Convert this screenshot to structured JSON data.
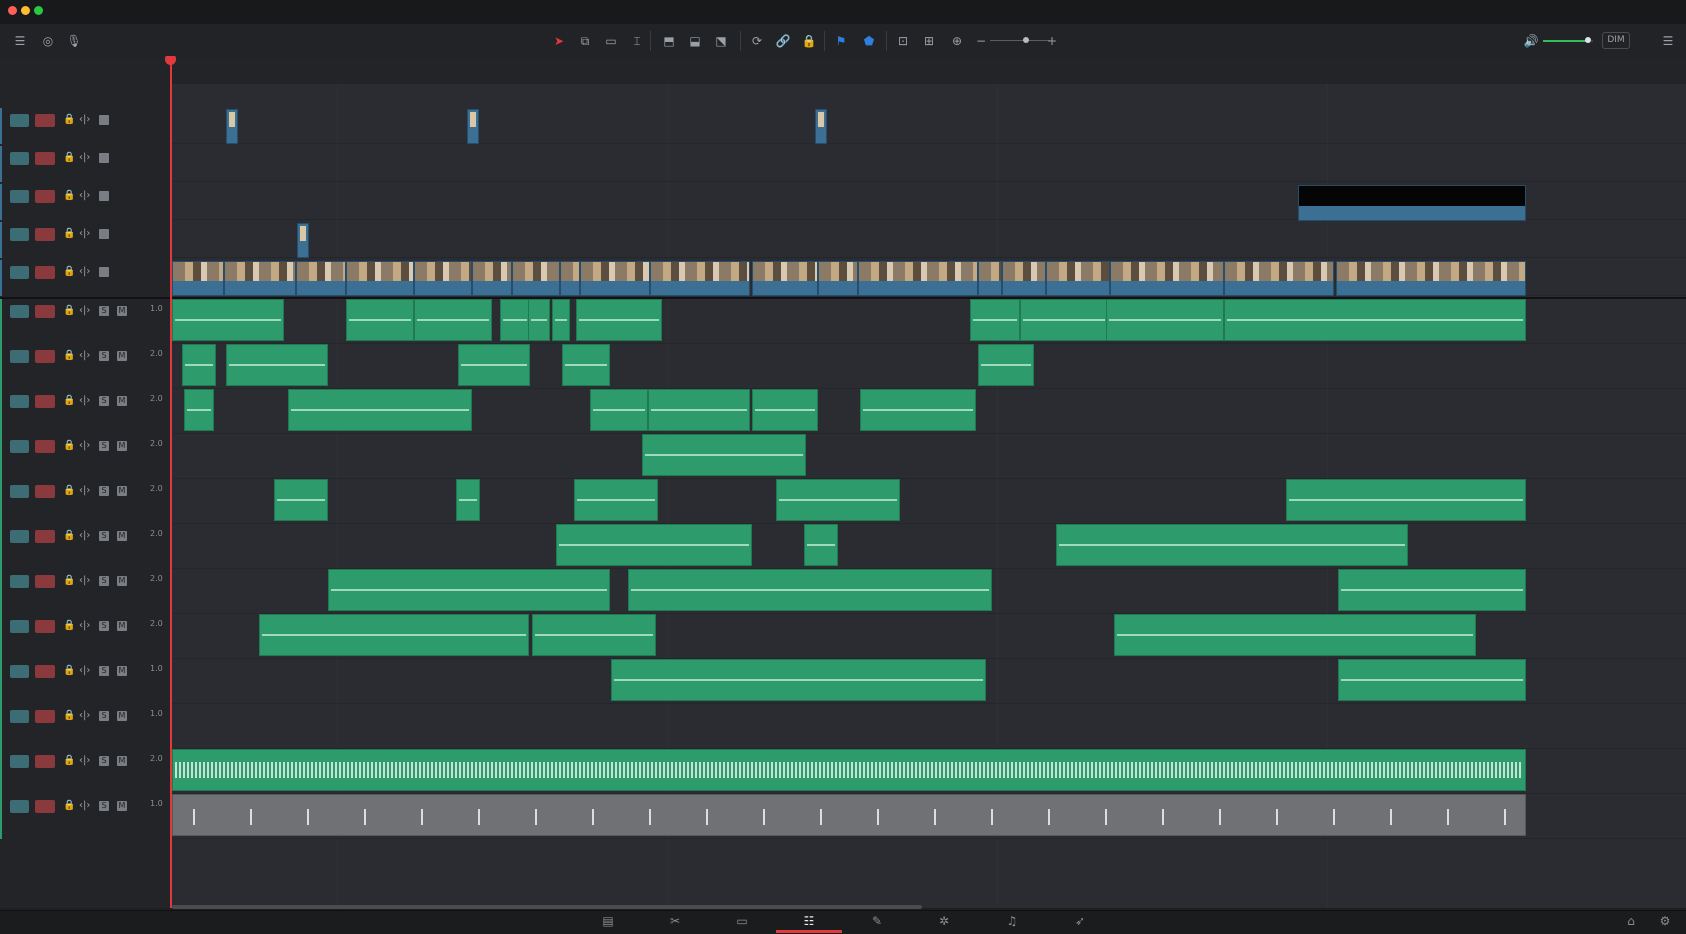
{
  "window": {
    "title": "",
    "traffic_lights": [
      "#ff5f57",
      "#febc2e",
      "#28c840"
    ]
  },
  "toolbar": {
    "left_tools": [
      {
        "name": "timeline-view-icon",
        "glyph": "☰"
      },
      {
        "name": "snapping-icon",
        "glyph": "◎"
      },
      {
        "name": "mic-icon",
        "glyph": "🎙"
      }
    ],
    "edit_tools": [
      {
        "name": "selection-pointer-icon",
        "glyph": "➤",
        "active": true
      },
      {
        "name": "trim-edit-icon",
        "glyph": "⧉"
      },
      {
        "name": "dynamic-trim-icon",
        "glyph": "▭"
      },
      {
        "name": "blade-icon",
        "glyph": "⌶"
      },
      {
        "name": "insert-clip-icon",
        "glyph": "⬒"
      },
      {
        "name": "overwrite-clip-icon",
        "glyph": "⬓"
      },
      {
        "name": "replace-clip-icon",
        "glyph": "⬔"
      },
      {
        "name": "snap-toggle-icon",
        "glyph": "⟳"
      },
      {
        "name": "link-icon",
        "glyph": "🔗"
      },
      {
        "name": "lock-icon",
        "glyph": "🔒"
      },
      {
        "name": "flag-icon",
        "glyph": "⚑"
      },
      {
        "name": "marker-icon",
        "glyph": "⬟"
      },
      {
        "name": "zoom-full-icon",
        "glyph": "⊡"
      },
      {
        "name": "zoom-detail-icon",
        "glyph": "⊞"
      },
      {
        "name": "zoom-custom-icon",
        "glyph": "⊕"
      }
    ],
    "zoom_minus": "−",
    "zoom_plus": "+",
    "zoom_level": 0.6,
    "volume_level": 0.9,
    "dim_label": "DIM"
  },
  "accent_colors": {
    "playhead": "#e0393e",
    "video_clip": "#3b6f93",
    "audio_clip": "#2d9b6b",
    "music_clip": "#6f7175",
    "enable_button": "#3c6c74",
    "record_button": "#8a3a3d"
  },
  "video_tracks": [
    {
      "id": "V5"
    },
    {
      "id": "V4"
    },
    {
      "id": "V3"
    },
    {
      "id": "V2"
    },
    {
      "id": "V1"
    }
  ],
  "audio_tracks": [
    {
      "id": "A1",
      "channel": "1.0"
    },
    {
      "id": "A2",
      "channel": "2.0"
    },
    {
      "id": "A3",
      "channel": "2.0"
    },
    {
      "id": "A4",
      "channel": "2.0"
    },
    {
      "id": "A5",
      "channel": "2.0"
    },
    {
      "id": "A6",
      "channel": "2.0"
    },
    {
      "id": "A7",
      "channel": "2.0"
    },
    {
      "id": "A8",
      "channel": "2.0"
    },
    {
      "id": "A9",
      "channel": "1.0"
    },
    {
      "id": "A10",
      "channel": "1.0"
    },
    {
      "id": "A11",
      "channel": "2.0"
    },
    {
      "id": "A12",
      "channel": "1.0"
    }
  ],
  "solo_label": "S",
  "mute_label": "M",
  "pages": [
    {
      "name": "media-page-icon",
      "glyph": "▤"
    },
    {
      "name": "cut-page-icon",
      "glyph": "✂"
    },
    {
      "name": "edit-page-icon",
      "glyph": "▭"
    },
    {
      "name": "timeline-page-icon",
      "glyph": "☷",
      "active": true
    },
    {
      "name": "color-page-icon",
      "glyph": "✎"
    },
    {
      "name": "fusion-page-icon",
      "glyph": "✲"
    },
    {
      "name": "fairlight-page-icon",
      "glyph": "♫"
    },
    {
      "name": "deliver-page-icon",
      "glyph": "➶"
    }
  ],
  "bottom_right": [
    {
      "name": "home-icon",
      "glyph": "⌂"
    },
    {
      "name": "settings-icon",
      "glyph": "⚙"
    }
  ]
}
